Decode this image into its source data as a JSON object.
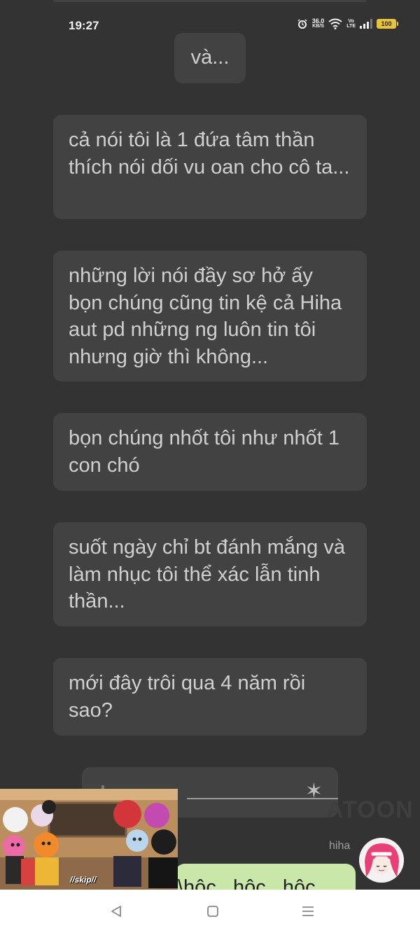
{
  "status_bar": {
    "time": "19:27",
    "speed_value": "36.0",
    "speed_unit": "KB/S",
    "volte_top": "Vo",
    "volte_bottom": "LTE",
    "battery": "100"
  },
  "messages": [
    {
      "text": "và..."
    },
    {
      "text": "cả nói tôi là 1 đứa tâm thần thích nói dối vu oan cho cô ta..."
    },
    {
      "text": "những lời nói đầy sơ hở ấy bọn chúng cũng tin kệ cả Hiha aut pd những ng luôn tin tôi nhưng giờ thì không..."
    },
    {
      "text": "bọn chúng nhốt tôi như nhốt 1 con chó"
    },
    {
      "text": "suốt ngày chỉ bt đánh mắng và làm nhục tôi thể xác lẫn tinh thần..."
    },
    {
      "text": "mới đây trôi qua 4 năm rồi sao?"
    }
  ],
  "divider": {
    "star": "✶"
  },
  "watermark": "ATOON",
  "reply": {
    "sender": "hiha",
    "text": "\\hôc...hôc...hôc"
  },
  "video_thumbnail": {
    "label": "//skip//"
  },
  "nav": {
    "back_icon": "back-triangle-icon",
    "home_icon": "home-square-icon",
    "menu_icon": "menu-lines-icon"
  },
  "colors": {
    "background": "#333333",
    "bubble": "#424242",
    "reply_bubble": "#c8e7a8",
    "battery": "#e8c43a"
  }
}
